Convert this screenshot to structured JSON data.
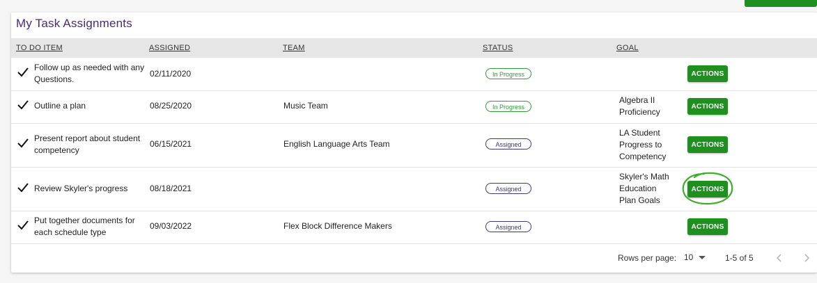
{
  "card": {
    "title": "My Task Assignments"
  },
  "table": {
    "headers": [
      "TO DO ITEM",
      "ASSIGNED",
      "TEAM",
      "STATUS",
      "GOAL"
    ],
    "rows": [
      {
        "item": "Follow up as needed with any Questions.",
        "assigned": "02/11/2020",
        "team": "",
        "status": "In Progress",
        "goal": "",
        "action": "ACTIONS"
      },
      {
        "item": "Outline a plan",
        "assigned": "08/25/2020",
        "team": "Music Team",
        "status": "In Progress",
        "goal": "Algebra II Proficiency",
        "action": "ACTIONS"
      },
      {
        "item": "Present report about student competency",
        "assigned": "06/15/2021",
        "team": "English Language Arts Team",
        "status": "Assigned",
        "goal": "LA Student Progress to Competency",
        "action": "ACTIONS"
      },
      {
        "item": "Review Skyler's progress",
        "assigned": "08/18/2021",
        "team": "",
        "status": "Assigned",
        "goal": "Skyler's Math Education Plan Goals",
        "action": "ACTIONS"
      },
      {
        "item": "Put together documents for each schedule type",
        "assigned": "09/03/2022",
        "team": "Flex Block Difference Makers",
        "status": "Assigned",
        "goal": "",
        "action": "ACTIONS"
      }
    ]
  },
  "pagination": {
    "rows_per_page_label": "Rows per page:",
    "rows_per_page_value": "10",
    "range": "1-5 of 5"
  },
  "colors": {
    "accent_green": "#1f8f1f",
    "title_purple": "#4a2a7a",
    "in_progress": "#2e9b3a",
    "assigned": "#3a3a7a"
  },
  "icons": [
    "check-icon",
    "dropdown-arrow-icon",
    "chevron-left-icon",
    "chevron-right-icon"
  ]
}
